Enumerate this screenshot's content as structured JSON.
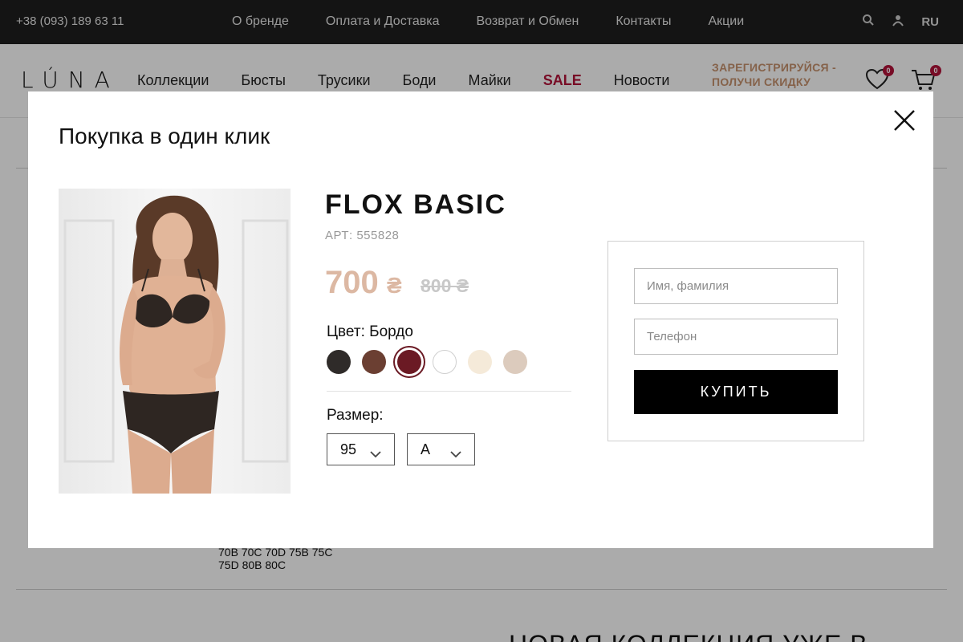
{
  "topbar": {
    "phone": "+38 (093) 189 63 11",
    "nav": [
      "О бренде",
      "Оплата и Доставка",
      "Возврат и Обмен",
      "Контакты",
      "Акции"
    ],
    "lang": "RU"
  },
  "header": {
    "logo": "LÚNA",
    "nav": [
      "Коллекции",
      "Бюсты",
      "Трусики",
      "Боди",
      "Майки",
      "SALE",
      "Новости"
    ],
    "promo": "ЗАРЕГИСТРИРУЙСЯ - ПОЛУЧИ СКИДКУ",
    "wishlist_count": "0",
    "cart_count": "0"
  },
  "background": {
    "sizes_line1": "70B 70C 70D 75B 75C",
    "sizes_line2": "75D 80B 80C",
    "heading": "НОВАЯ КОЛЛЕКЦИЯ УЖЕ В"
  },
  "modal": {
    "title": "Покупка в один клик",
    "product": {
      "name": "FLOX BASIC",
      "article": "АРТ: 555828",
      "price": "700",
      "currency": "₴",
      "old_price": "800 ₴",
      "color_label": "Цвет:",
      "color_value": "Бордо",
      "swatches": [
        "#2f2b29",
        "#6b3f32",
        "#6b1a24",
        "#ffffff",
        "#f5ead9",
        "#dccbbd"
      ],
      "size_label": "Размер:",
      "size_band": "95",
      "size_cup": "A"
    },
    "form": {
      "name_placeholder": "Имя, фамилия",
      "phone_placeholder": "Телефон",
      "buy_label": "КУПИТЬ"
    }
  }
}
